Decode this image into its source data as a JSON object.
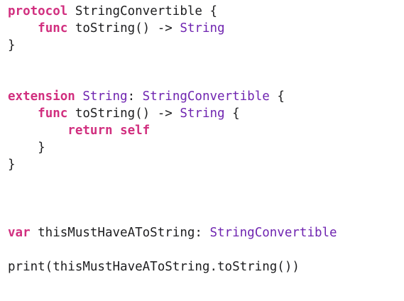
{
  "colors": {
    "background": "#ffffff",
    "keyword": "#d12f7f",
    "type": "#6f24b0",
    "plain": "#1d1d1f"
  },
  "code_lines": [
    [
      {
        "text": "protocol",
        "kind": "keyword"
      },
      {
        "text": " StringConvertible {",
        "kind": "plain"
      }
    ],
    [
      {
        "text": "    ",
        "kind": "plain"
      },
      {
        "text": "func",
        "kind": "keyword"
      },
      {
        "text": " toString() -> ",
        "kind": "plain"
      },
      {
        "text": "String",
        "kind": "type"
      }
    ],
    [
      {
        "text": "}",
        "kind": "plain"
      }
    ],
    [],
    [],
    [
      {
        "text": "extension",
        "kind": "keyword"
      },
      {
        "text": " ",
        "kind": "plain"
      },
      {
        "text": "String",
        "kind": "type"
      },
      {
        "text": ": ",
        "kind": "plain"
      },
      {
        "text": "StringConvertible",
        "kind": "type"
      },
      {
        "text": " {",
        "kind": "plain"
      }
    ],
    [
      {
        "text": "    ",
        "kind": "plain"
      },
      {
        "text": "func",
        "kind": "keyword"
      },
      {
        "text": " toString() -> ",
        "kind": "plain"
      },
      {
        "text": "String",
        "kind": "type"
      },
      {
        "text": " {",
        "kind": "plain"
      }
    ],
    [
      {
        "text": "        ",
        "kind": "plain"
      },
      {
        "text": "return",
        "kind": "keyword"
      },
      {
        "text": " ",
        "kind": "plain"
      },
      {
        "text": "self",
        "kind": "keyword"
      }
    ],
    [
      {
        "text": "    }",
        "kind": "plain"
      }
    ],
    [
      {
        "text": "}",
        "kind": "plain"
      }
    ],
    [],
    [],
    [],
    [
      {
        "text": "var",
        "kind": "keyword"
      },
      {
        "text": " thisMustHaveAToString: ",
        "kind": "plain"
      },
      {
        "text": "StringConvertible",
        "kind": "type"
      }
    ],
    [],
    [
      {
        "text": "print(thisMustHaveAToString.toString())",
        "kind": "plain"
      }
    ]
  ]
}
